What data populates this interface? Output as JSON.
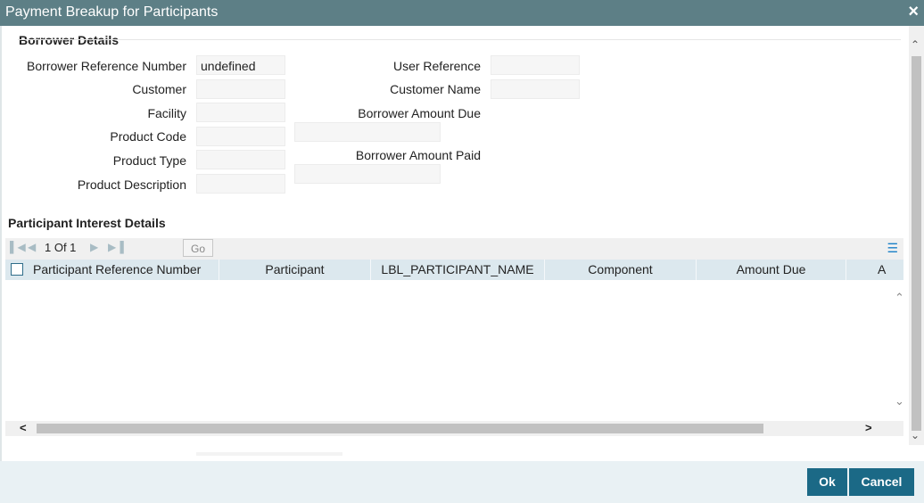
{
  "window": {
    "title": "Payment Breakup for Participants",
    "close_icon": "×"
  },
  "borrower": {
    "section_title": "Borrower Details",
    "left_fields": [
      {
        "label": "Borrower Reference Number",
        "value": "undefined"
      },
      {
        "label": "Customer",
        "value": ""
      },
      {
        "label": "Facility",
        "value": ""
      },
      {
        "label": "Product Code",
        "value": ""
      },
      {
        "label": "Product Type",
        "value": ""
      },
      {
        "label": "Product Description",
        "value": ""
      }
    ],
    "right_fields": [
      {
        "label": "User Reference",
        "value": ""
      },
      {
        "label": "Customer Name",
        "value": ""
      },
      {
        "label": "Borrower Amount Due",
        "value": ""
      },
      {
        "label": "Borrower Amount Paid",
        "value": ""
      }
    ]
  },
  "participants": {
    "section_title": "Participant Interest Details",
    "pagination": {
      "text": "1 Of 1",
      "go_label": "Go"
    },
    "columns": [
      "Participant Reference Number",
      "Participant",
      "LBL_PARTICIPANT_NAME",
      "Component",
      "Amount Due",
      "A"
    ],
    "rows": []
  },
  "footer": {
    "ok_label": "Ok",
    "cancel_label": "Cancel"
  },
  "colors": {
    "titlebar": "#5d7f86",
    "button": "#1b6986",
    "grid_header": "#dce8ee",
    "footer": "#e9f1f4"
  }
}
